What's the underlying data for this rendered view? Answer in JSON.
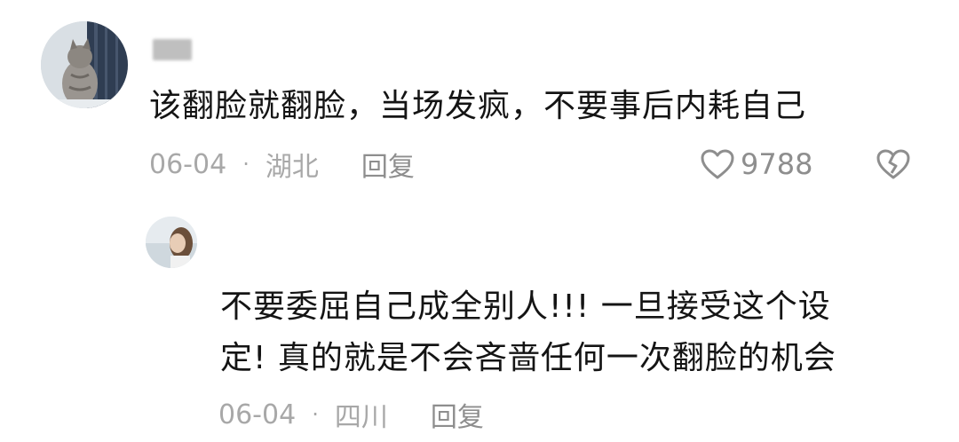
{
  "comment": {
    "text": "该翻脸就翻脸，当场发疯，不要事后内耗自己",
    "date": "06-04",
    "separator": "·",
    "location": "湖北",
    "reply_label": "回复",
    "like_count": "9788",
    "icons": [
      "heart-icon",
      "broken-heart-icon"
    ]
  },
  "reply": {
    "text_line1": "不要委屈自己成全别人!!! 一旦接受这个设",
    "text_line2": "定! 真的就是不会吝啬任何一次翻脸的机会",
    "date": "06-04",
    "separator": "·",
    "location": "四川",
    "reply_label": "回复"
  },
  "colors": {
    "text": "#141414",
    "meta": "#a8a8a8",
    "icon": "#8e8e8e",
    "background": "#ffffff"
  }
}
